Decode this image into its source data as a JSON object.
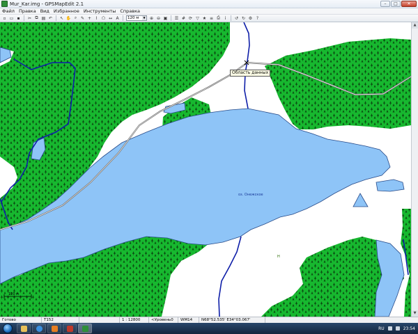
{
  "window": {
    "title": "Mur_Kar.img - GPSMapEdit 2.1",
    "min": "–",
    "max": "□",
    "close": "✕"
  },
  "menu": {
    "items": [
      "Файл",
      "Правка",
      "Вид",
      "Избранное",
      "Инструменты",
      "Справка"
    ]
  },
  "toolbar": {
    "zoom_value": "120 м"
  },
  "map": {
    "tooltip": "Область данных",
    "label_lake": "оз. Онежское",
    "label_point": "Н",
    "scale_label": "120 м",
    "colors": {
      "forest": "#17b82f",
      "water": "#8ec4f7",
      "land": "#ffffff",
      "river": "#0e1ea8",
      "road": "#7a7a7a"
    }
  },
  "status": {
    "ready": "Готово",
    "grid": "T152",
    "scale": "1 : 12800",
    "level": "<Уровень0",
    "datum": "WM14",
    "coords": "N68°52.535' E34°03.067'"
  },
  "taskbar": {
    "lang": "RU",
    "time": "23:54"
  }
}
